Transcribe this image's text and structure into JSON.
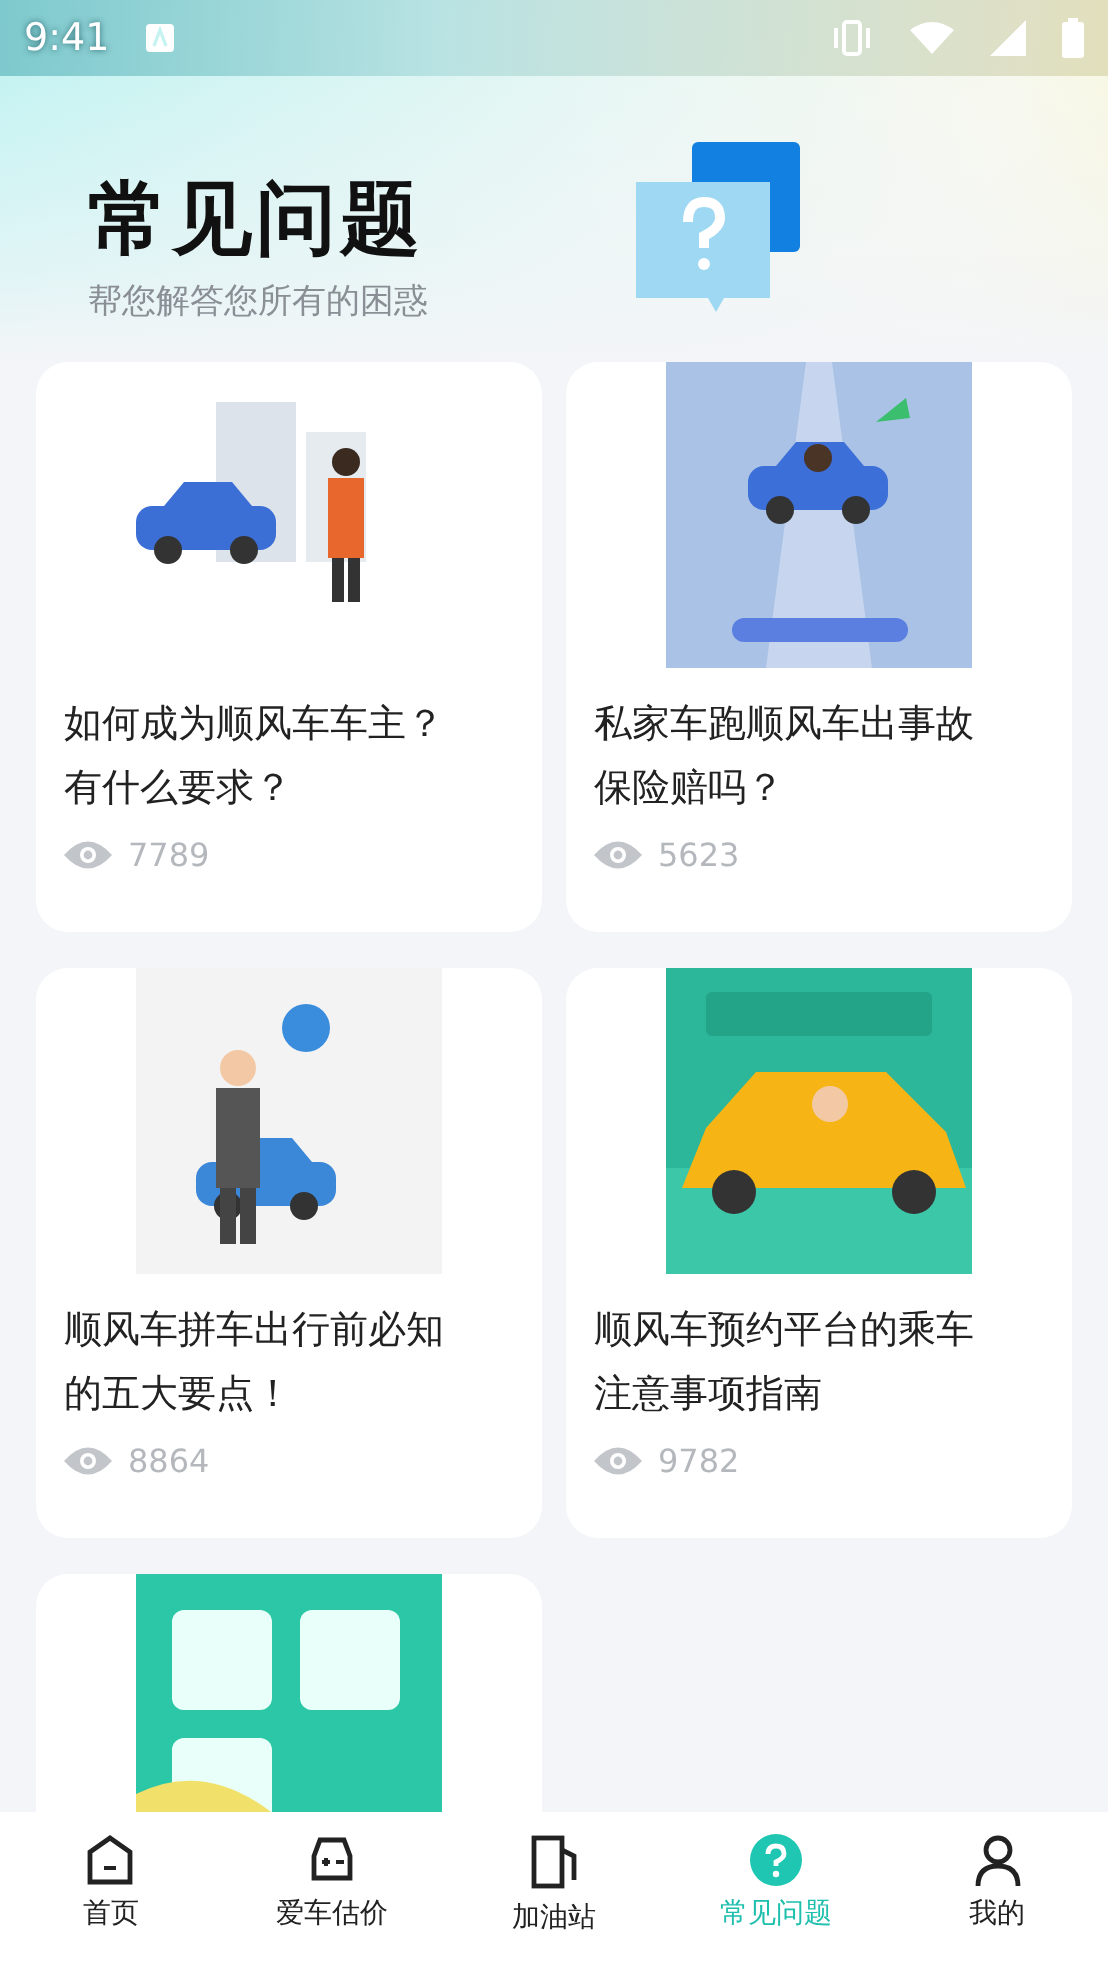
{
  "status_bar": {
    "time": "9:41"
  },
  "header": {
    "title": "常见问题",
    "subtitle": "帮您解答您所有的困惑"
  },
  "articles": [
    {
      "kind": "article",
      "title": "如何成为顺风车车主？有什么要求？",
      "views": "7789"
    },
    {
      "kind": "article",
      "title": "私家车跑顺风车出事故保险赔吗？",
      "views": "5623"
    },
    {
      "kind": "article",
      "title": "顺风车拼车出行前必知的五大要点！",
      "views": "8864"
    },
    {
      "kind": "article",
      "title": "顺风车预约平台的乘车注意事项指南",
      "views": "9782"
    },
    {
      "kind": "picture"
    }
  ],
  "tabs": [
    {
      "label": "首页",
      "selected": false
    },
    {
      "label": "爱车估价",
      "selected": false
    },
    {
      "label": "加油站",
      "selected": false
    },
    {
      "label": "常见问题",
      "selected": true
    },
    {
      "label": "我的",
      "selected": false
    }
  ]
}
